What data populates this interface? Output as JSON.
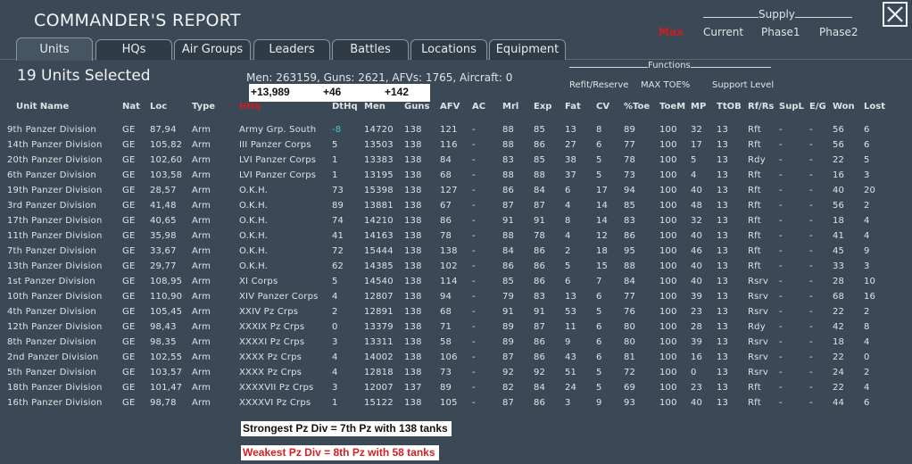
{
  "title": "COMMANDER'S REPORT",
  "close_label": "close",
  "supply": {
    "header": "Supply",
    "options": [
      {
        "label": "Max",
        "active": true
      },
      {
        "label": "Current",
        "active": false
      },
      {
        "label": "Phase1",
        "active": false
      },
      {
        "label": "Phase2",
        "active": false
      }
    ]
  },
  "tabs": [
    "Units",
    "HQs",
    "Air Groups",
    "Leaders",
    "Battles",
    "Locations",
    "Equipment"
  ],
  "active_tab": "Units",
  "selected_text": "19 Units Selected",
  "summary_text": "Men: 263159, Guns: 2621, AFVs: 1765, Aircraft: 0",
  "totals_annotation": {
    "men": "+13,989",
    "guns": "+46",
    "afvs": "+142"
  },
  "functions": {
    "header": "Functions",
    "options": [
      "Refit/Reserve",
      "MAX TOE%",
      "Support Level"
    ]
  },
  "columns": [
    "Unit Name",
    "Nat",
    "Loc",
    "Type",
    "HHq",
    "DtHq",
    "Men",
    "Guns",
    "AFV",
    "AC",
    "Mrl",
    "Exp",
    "Fat",
    "CV",
    "%Toe",
    "ToeM",
    "MP",
    "TtOB",
    "Rf/Rs",
    "SupL",
    "E/G",
    "Won",
    "Lost"
  ],
  "sorted_column": "HHq",
  "rows": [
    [
      "9th Panzer Division",
      "GE",
      "87,94",
      "Arm",
      "Army Grp. South",
      "-8",
      "14720",
      "138",
      "121",
      "-",
      "88",
      "85",
      "13",
      "8",
      "89",
      "100",
      "32",
      "13",
      "Rft",
      "-",
      "-",
      "56",
      "6"
    ],
    [
      "14th Panzer Division",
      "GE",
      "105,82",
      "Arm",
      "III Panzer Corps",
      "5",
      "13503",
      "138",
      "116",
      "-",
      "88",
      "86",
      "27",
      "6",
      "77",
      "100",
      "17",
      "13",
      "Rft",
      "-",
      "-",
      "56",
      "6"
    ],
    [
      "20th Panzer Division",
      "GE",
      "102,60",
      "Arm",
      "LVI Panzer Corps",
      "1",
      "13383",
      "138",
      "84",
      "-",
      "83",
      "85",
      "38",
      "5",
      "78",
      "100",
      "5",
      "13",
      "Rdy",
      "-",
      "-",
      "22",
      "5"
    ],
    [
      "6th Panzer Division",
      "GE",
      "103,58",
      "Arm",
      "LVI Panzer Corps",
      "1",
      "13195",
      "138",
      "68",
      "-",
      "88",
      "88",
      "37",
      "5",
      "73",
      "100",
      "4",
      "13",
      "Rft",
      "-",
      "-",
      "16",
      "3"
    ],
    [
      "19th Panzer Division",
      "GE",
      "28,57",
      "Arm",
      "O.K.H.",
      "73",
      "15398",
      "138",
      "127",
      "-",
      "86",
      "84",
      "6",
      "17",
      "94",
      "100",
      "40",
      "13",
      "Rft",
      "-",
      "-",
      "40",
      "20"
    ],
    [
      "3rd Panzer Division",
      "GE",
      "41,48",
      "Arm",
      "O.K.H.",
      "89",
      "13881",
      "138",
      "67",
      "-",
      "87",
      "87",
      "4",
      "14",
      "85",
      "100",
      "48",
      "13",
      "Rft",
      "-",
      "-",
      "56",
      "2"
    ],
    [
      "17th Panzer Division",
      "GE",
      "40,65",
      "Arm",
      "O.K.H.",
      "74",
      "14210",
      "138",
      "86",
      "-",
      "91",
      "91",
      "8",
      "14",
      "83",
      "100",
      "32",
      "13",
      "Rft",
      "-",
      "-",
      "18",
      "4"
    ],
    [
      "11th Panzer Division",
      "GE",
      "35,98",
      "Arm",
      "O.K.H.",
      "41",
      "14163",
      "138",
      "78",
      "-",
      "88",
      "78",
      "4",
      "12",
      "86",
      "100",
      "40",
      "13",
      "Rft",
      "-",
      "-",
      "41",
      "4"
    ],
    [
      "7th Panzer Division",
      "GE",
      "33,67",
      "Arm",
      "O.K.H.",
      "72",
      "15444",
      "138",
      "138",
      "-",
      "84",
      "86",
      "2",
      "18",
      "95",
      "100",
      "46",
      "13",
      "Rft",
      "-",
      "-",
      "45",
      "9"
    ],
    [
      "13th Panzer Division",
      "GE",
      "29,77",
      "Arm",
      "O.K.H.",
      "62",
      "14385",
      "138",
      "102",
      "-",
      "86",
      "86",
      "5",
      "15",
      "88",
      "100",
      "40",
      "13",
      "Rft",
      "-",
      "-",
      "33",
      "3"
    ],
    [
      "1st Panzer Division",
      "GE",
      "108,95",
      "Arm",
      "XI Corps",
      "5",
      "14540",
      "138",
      "114",
      "-",
      "85",
      "86",
      "6",
      "7",
      "84",
      "100",
      "40",
      "13",
      "Rsrv",
      "-",
      "-",
      "28",
      "10"
    ],
    [
      "10th Panzer Division",
      "GE",
      "110,90",
      "Arm",
      "XIV Panzer Corps",
      "4",
      "12807",
      "138",
      "94",
      "-",
      "79",
      "83",
      "13",
      "6",
      "77",
      "100",
      "39",
      "13",
      "Rsrv",
      "-",
      "-",
      "68",
      "16"
    ],
    [
      "4th Panzer Division",
      "GE",
      "105,45",
      "Arm",
      "XXIV Pz Crps",
      "2",
      "12891",
      "138",
      "68",
      "-",
      "91",
      "91",
      "53",
      "5",
      "76",
      "100",
      "23",
      "13",
      "Rsrv",
      "-",
      "-",
      "22",
      "2"
    ],
    [
      "12th Panzer Division",
      "GE",
      "98,43",
      "Arm",
      "XXXIX Pz Crps",
      "0",
      "13379",
      "138",
      "71",
      "-",
      "89",
      "87",
      "11",
      "6",
      "80",
      "100",
      "28",
      "13",
      "Rdy",
      "-",
      "-",
      "42",
      "8"
    ],
    [
      "8th Panzer Division",
      "GE",
      "98,35",
      "Arm",
      "XXXXI Pz Crps",
      "3",
      "13311",
      "138",
      "58",
      "-",
      "89",
      "86",
      "9",
      "6",
      "80",
      "100",
      "39",
      "13",
      "Rsrv",
      "-",
      "-",
      "18",
      "4"
    ],
    [
      "2nd Panzer Division",
      "GE",
      "102,55",
      "Arm",
      "XXXX Pz Crps",
      "4",
      "14002",
      "138",
      "106",
      "-",
      "87",
      "86",
      "43",
      "6",
      "81",
      "100",
      "16",
      "13",
      "Rsrv",
      "-",
      "-",
      "22",
      "0"
    ],
    [
      "5th Panzer Division",
      "GE",
      "103,57",
      "Arm",
      "XXXX Pz Crps",
      "4",
      "12818",
      "138",
      "73",
      "-",
      "92",
      "92",
      "51",
      "5",
      "72",
      "100",
      "0",
      "13",
      "Rsrv",
      "-",
      "-",
      "24",
      "2"
    ],
    [
      "18th Panzer Division",
      "GE",
      "101,47",
      "Arm",
      "XXXXVII Pz Crps",
      "3",
      "12007",
      "137",
      "89",
      "-",
      "82",
      "84",
      "24",
      "5",
      "69",
      "100",
      "23",
      "13",
      "Rft",
      "-",
      "-",
      "22",
      "4"
    ],
    [
      "16th Panzer Division",
      "GE",
      "98,78",
      "Arm",
      "XXXXVI Pz Crps",
      "1",
      "15122",
      "138",
      "105",
      "-",
      "87",
      "86",
      "3",
      "9",
      "93",
      "100",
      "40",
      "13",
      "Rft",
      "-",
      "-",
      "44",
      "6"
    ]
  ],
  "notes": {
    "strongest": "Strongest Pz Div = 7th Pz with 138 tanks",
    "weakest": "Weakest Pz Div = 8th Pz with 58 tanks"
  },
  "colors": {
    "background": "#3b4956",
    "highlight_red": "#c62020",
    "highlight_cyan": "#4fc6d2",
    "text": "#dfe3e6"
  }
}
